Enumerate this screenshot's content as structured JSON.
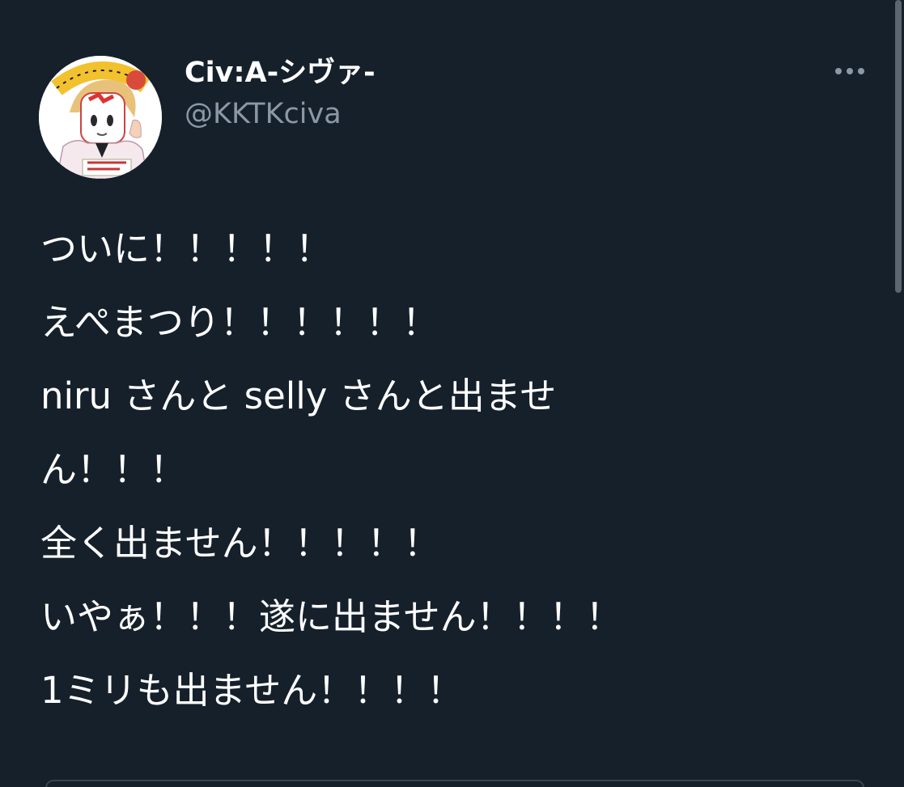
{
  "tweet": {
    "author": {
      "display_name": "Civ:A-シヴァ-",
      "handle": "@KKTKciva",
      "avatar_icon": "user-avatar-icon"
    },
    "more_icon": "more-horizontal-icon",
    "text_lines": [
      "ついに！！！！！",
      "えぺまつり！！！！！！",
      "niru さんと selly さんと出ませ",
      "ん！！！",
      "全く出ません！！！！！",
      "いやぁ！！！遂に出ません！！！！",
      "1ミリも出ません！！！！"
    ]
  },
  "colors": {
    "background": "#15202b",
    "primary_text": "#ffffff",
    "secondary_text": "#8b98a5",
    "border": "#38444d"
  }
}
